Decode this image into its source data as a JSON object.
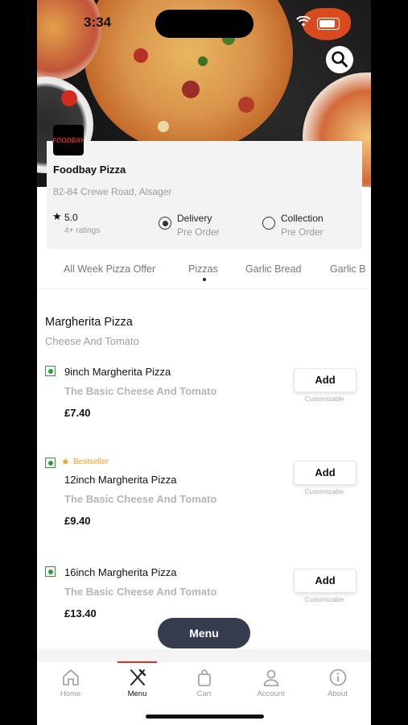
{
  "status_bar": {
    "time": "3:34"
  },
  "restaurant": {
    "logo_text": "FOODBAY",
    "name": "Foodbay Pizza",
    "address": "82-84 Crewe Road, Alsager",
    "rating": "5.0",
    "ratings_count": "4+ ratings"
  },
  "order_options": [
    {
      "label": "Delivery",
      "sub": "Pre Order",
      "selected": true
    },
    {
      "label": "Collection",
      "sub": "Pre Order",
      "selected": false
    }
  ],
  "categories": [
    "All Week Pizza Offer",
    "Pizzas",
    "Garlic Bread",
    "Garlic B"
  ],
  "active_category": "Pizzas",
  "section": {
    "title": "Margherita  Pizza",
    "subtitle": "Cheese And Tomato"
  },
  "items": [
    {
      "name": "9inch Margherita Pizza",
      "desc": "The Basic Cheese And Tomato",
      "price": "£7.40",
      "bestseller": "",
      "add_label": "Add",
      "custom_label": "Customizable"
    },
    {
      "name": "12inch Margherita Pizza",
      "desc": "The Basic Cheese And Tomato",
      "price": "£9.40",
      "bestseller": "Bestseller",
      "add_label": "Add",
      "custom_label": "Customizable"
    },
    {
      "name": "16inch Margherita Pizza",
      "desc": "The Basic Cheese And Tomato",
      "price": "£13.40",
      "bestseller": "",
      "add_label": "Add",
      "custom_label": "Customizable"
    }
  ],
  "menu_button": "Menu",
  "bottom_nav": [
    {
      "label": "Home",
      "icon": "home-icon"
    },
    {
      "label": "Menu",
      "icon": "cutlery-icon"
    },
    {
      "label": "Cart",
      "icon": "bag-icon"
    },
    {
      "label": "Account",
      "icon": "user-icon"
    },
    {
      "label": "About",
      "icon": "info-icon"
    }
  ],
  "active_nav": "Menu",
  "colors": {
    "accent": "#d6332a",
    "veg": "#2e9a3a",
    "bestseller": "#f0a020",
    "fab": "#353c4d"
  }
}
